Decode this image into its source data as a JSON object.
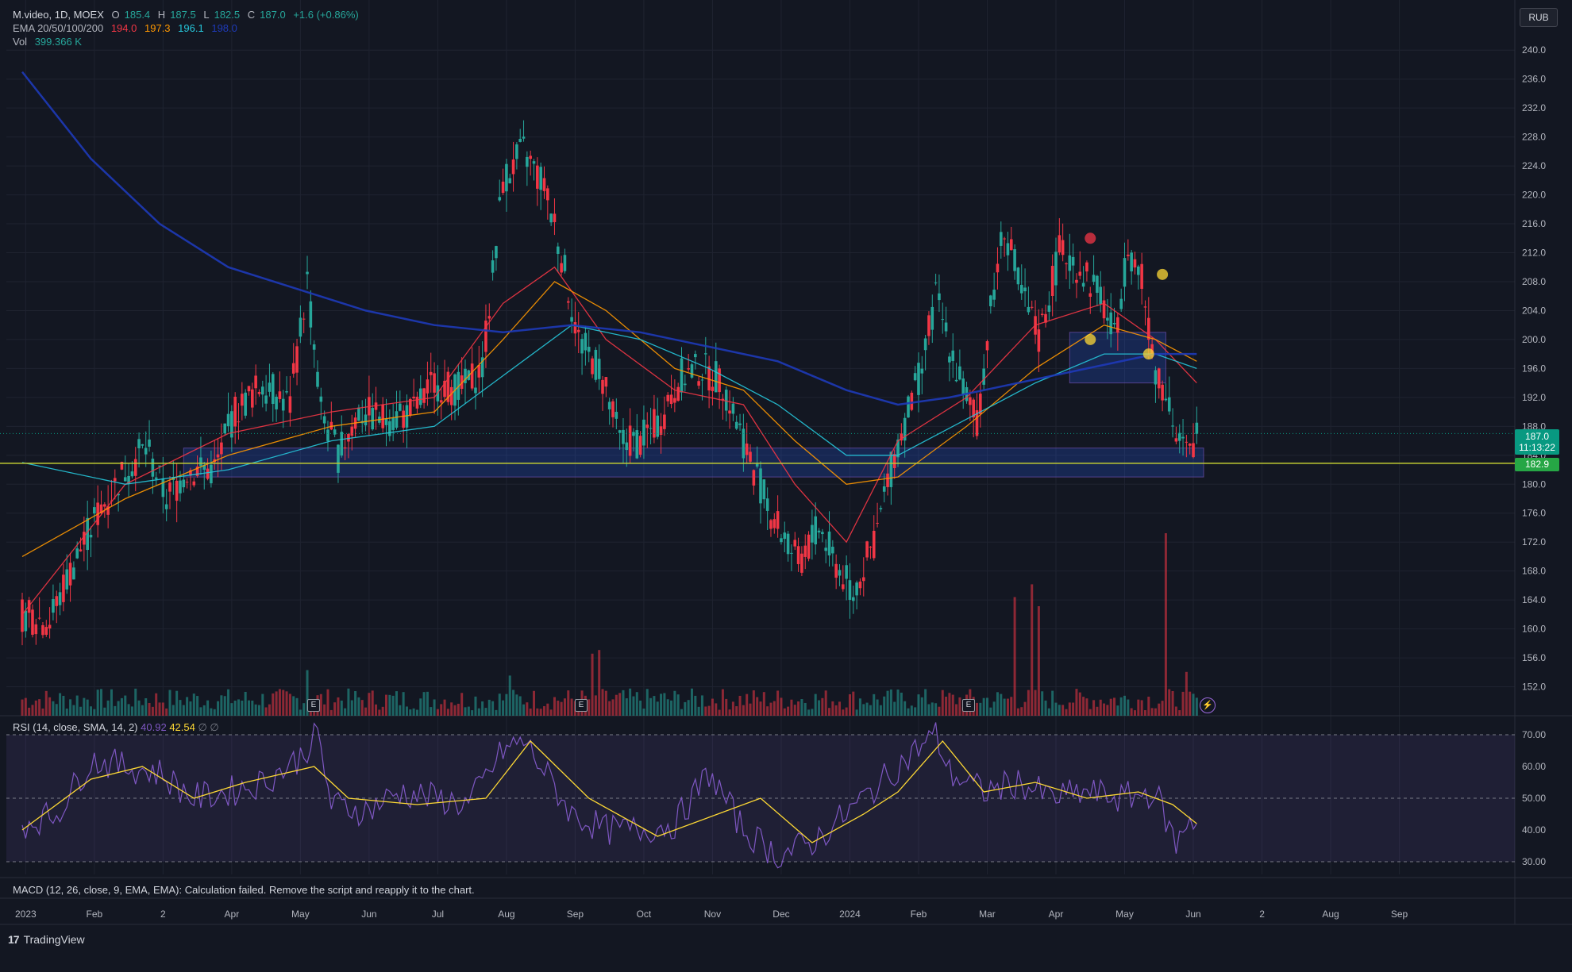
{
  "legend": {
    "symbol": "M.video, 1D, MOEX",
    "ohlc": [
      {
        "k": "O",
        "v": "185.4"
      },
      {
        "k": "H",
        "v": "187.5"
      },
      {
        "k": "L",
        "v": "182.5"
      },
      {
        "k": "C",
        "v": "187.0"
      }
    ],
    "change": "+1.6 (+0.86%)",
    "ema_label": "EMA 20/50/100/200",
    "ema_values": [
      {
        "v": "194.0",
        "color": "#f23645"
      },
      {
        "v": "197.3",
        "color": "#ff9800"
      },
      {
        "v": "196.1",
        "color": "#26c6da"
      },
      {
        "v": "198.0",
        "color": "#1e3ab8"
      }
    ],
    "vol_label": "Vol",
    "vol_value": "399.366 K",
    "rsi_label": "RSI (14, close, SMA, 14, 2)",
    "rsi_value": "40.92",
    "rsi_ma_value": "42.54",
    "rsi_extra": "∅  ∅",
    "macd_message": "MACD (12, 26, close, 9, EMA, EMA): Calculation failed. Remove the script and reapply it to the chart."
  },
  "currency": "RUB",
  "brand": "TradingView",
  "price_tags": {
    "last_price": "187.0",
    "countdown": "11:13:22",
    "level": "182.9"
  },
  "earnings_badge": "E",
  "colors": {
    "up": "#26a69a",
    "down": "#f23645",
    "ema20": "#f23645",
    "ema50": "#ff9800",
    "ema100": "#26c6da",
    "ema200": "#1e3ab8",
    "rsi": "#7e57c2",
    "rsi_ma": "#fdd835",
    "zone": "#2962ff",
    "level": "#c0ca33"
  },
  "chart_data": {
    "type": "candlestick",
    "title": "M.video, 1D, MOEX",
    "price_axis": {
      "min": 148,
      "max": 242,
      "ticks": [
        152,
        156,
        160,
        164,
        168,
        172,
        176,
        180,
        184,
        188,
        192,
        196,
        200,
        204,
        208,
        212,
        216,
        220,
        224,
        228,
        232,
        236,
        240
      ],
      "tick_labels": [
        "152.0",
        "156.0",
        "160.0",
        "164.0",
        "168.0",
        "172.0",
        "176.0",
        "180.0",
        "184.0",
        "188.0",
        "192.0",
        "196.0",
        "200.0",
        "204.0",
        "208.0",
        "212.0",
        "216.0",
        "220.0",
        "224.0",
        "228.0",
        "232.0",
        "236.0",
        "240.0"
      ]
    },
    "time_axis": {
      "labels": [
        "2023",
        "Feb",
        "2",
        "Apr",
        "May",
        "Jun",
        "Jul",
        "Aug",
        "Sep",
        "Oct",
        "Nov",
        "Dec",
        "2024",
        "Feb",
        "Mar",
        "Apr",
        "May",
        "Jun",
        "2",
        "Aug",
        "Sep"
      ],
      "label_index": [
        1,
        21,
        41,
        61,
        81,
        101,
        121,
        141,
        161,
        181,
        201,
        221,
        241,
        261,
        281,
        301,
        321,
        341,
        361,
        381,
        401
      ]
    },
    "price_path": [
      [
        0,
        162
      ],
      [
        8,
        161
      ],
      [
        14,
        168
      ],
      [
        22,
        176
      ],
      [
        30,
        182
      ],
      [
        36,
        185
      ],
      [
        42,
        178
      ],
      [
        48,
        182
      ],
      [
        56,
        182
      ],
      [
        62,
        190
      ],
      [
        70,
        194
      ],
      [
        78,
        191
      ],
      [
        83,
        208
      ],
      [
        87,
        190
      ],
      [
        92,
        184
      ],
      [
        98,
        190
      ],
      [
        106,
        189
      ],
      [
        114,
        190
      ],
      [
        120,
        194
      ],
      [
        128,
        193
      ],
      [
        134,
        196
      ],
      [
        140,
        222
      ],
      [
        146,
        226
      ],
      [
        152,
        221
      ],
      [
        156,
        214
      ],
      [
        162,
        200
      ],
      [
        168,
        196
      ],
      [
        174,
        186
      ],
      [
        180,
        186
      ],
      [
        186,
        189
      ],
      [
        192,
        195
      ],
      [
        198,
        196
      ],
      [
        204,
        194
      ],
      [
        210,
        186
      ],
      [
        218,
        176
      ],
      [
        226,
        169
      ],
      [
        232,
        174
      ],
      [
        238,
        168
      ],
      [
        242,
        165
      ],
      [
        248,
        172
      ],
      [
        254,
        184
      ],
      [
        262,
        196
      ],
      [
        266,
        206
      ],
      [
        272,
        196
      ],
      [
        278,
        188
      ],
      [
        282,
        204
      ],
      [
        286,
        216
      ],
      [
        290,
        208
      ],
      [
        296,
        200
      ],
      [
        302,
        212
      ],
      [
        308,
        210
      ],
      [
        314,
        206
      ],
      [
        318,
        200
      ],
      [
        322,
        213
      ],
      [
        326,
        208
      ],
      [
        330,
        196
      ],
      [
        334,
        192
      ],
      [
        336,
        186
      ],
      [
        340,
        184
      ],
      [
        342,
        187
      ]
    ],
    "ema_series": [
      {
        "period": 20,
        "values": [
          [
            0,
            162
          ],
          [
            30,
            180
          ],
          [
            60,
            187
          ],
          [
            90,
            190
          ],
          [
            120,
            192
          ],
          [
            140,
            205
          ],
          [
            155,
            210
          ],
          [
            170,
            200
          ],
          [
            190,
            193
          ],
          [
            210,
            191
          ],
          [
            225,
            180
          ],
          [
            240,
            172
          ],
          [
            255,
            186
          ],
          [
            275,
            192
          ],
          [
            295,
            202
          ],
          [
            315,
            205
          ],
          [
            330,
            200
          ],
          [
            342,
            194
          ]
        ]
      },
      {
        "period": 50,
        "values": [
          [
            0,
            170
          ],
          [
            30,
            178
          ],
          [
            60,
            184
          ],
          [
            90,
            188
          ],
          [
            120,
            190
          ],
          [
            140,
            200
          ],
          [
            155,
            208
          ],
          [
            170,
            204
          ],
          [
            190,
            196
          ],
          [
            210,
            193
          ],
          [
            225,
            186
          ],
          [
            240,
            180
          ],
          [
            255,
            181
          ],
          [
            275,
            188
          ],
          [
            295,
            196
          ],
          [
            315,
            202
          ],
          [
            330,
            200
          ],
          [
            342,
            197
          ]
        ]
      },
      {
        "period": 100,
        "values": [
          [
            0,
            183
          ],
          [
            30,
            180
          ],
          [
            60,
            182
          ],
          [
            90,
            186
          ],
          [
            120,
            188
          ],
          [
            140,
            195
          ],
          [
            160,
            202
          ],
          [
            180,
            200
          ],
          [
            200,
            196
          ],
          [
            220,
            191
          ],
          [
            240,
            184
          ],
          [
            255,
            184
          ],
          [
            275,
            189
          ],
          [
            295,
            194
          ],
          [
            315,
            198
          ],
          [
            330,
            198
          ],
          [
            342,
            196
          ]
        ]
      },
      {
        "period": 200,
        "values": [
          [
            0,
            237
          ],
          [
            20,
            225
          ],
          [
            40,
            216
          ],
          [
            60,
            210
          ],
          [
            80,
            207
          ],
          [
            100,
            204
          ],
          [
            120,
            202
          ],
          [
            140,
            201
          ],
          [
            160,
            202
          ],
          [
            180,
            201
          ],
          [
            200,
            199
          ],
          [
            220,
            197
          ],
          [
            240,
            193
          ],
          [
            255,
            191
          ],
          [
            270,
            192
          ],
          [
            290,
            194
          ],
          [
            310,
            196
          ],
          [
            330,
            198
          ],
          [
            342,
            198
          ]
        ]
      }
    ],
    "zones": [
      {
        "from_index": 47,
        "to_index": 344,
        "low": 181,
        "high": 185
      },
      {
        "from_index": 305,
        "to_index": 333,
        "low": 194,
        "high": 201
      }
    ],
    "horizontal_level": 182.9,
    "last_price": 187.0,
    "signal_markers": [
      {
        "index": 311,
        "price": 214,
        "color": "#f23645"
      },
      {
        "index": 311,
        "price": 200,
        "color": "#fdd835"
      },
      {
        "index": 328,
        "price": 198,
        "color": "#fdd835"
      },
      {
        "index": 332,
        "price": 209,
        "color": "#fdd835"
      }
    ],
    "earnings_events": [
      87,
      164,
      275
    ],
    "volume": {
      "scale_max": 100,
      "spikes": [
        [
          83,
          25
        ],
        [
          142,
          22
        ],
        [
          166,
          34
        ],
        [
          168,
          36
        ],
        [
          289,
          65
        ],
        [
          294,
          72
        ],
        [
          296,
          60
        ],
        [
          333,
          100
        ],
        [
          339,
          24
        ]
      ]
    },
    "rsi": {
      "levels": [
        30,
        50,
        70
      ],
      "tick_labels": [
        "70.00",
        "60.00",
        "50.00",
        "40.00",
        "30.00"
      ],
      "min": 26,
      "max": 74,
      "path": [
        [
          0,
          42
        ],
        [
          10,
          45
        ],
        [
          20,
          62
        ],
        [
          30,
          60
        ],
        [
          40,
          58
        ],
        [
          50,
          50
        ],
        [
          60,
          52
        ],
        [
          70,
          55
        ],
        [
          80,
          62
        ],
        [
          86,
          70
        ],
        [
          90,
          48
        ],
        [
          100,
          46
        ],
        [
          110,
          52
        ],
        [
          120,
          50
        ],
        [
          130,
          48
        ],
        [
          140,
          65
        ],
        [
          146,
          68
        ],
        [
          150,
          62
        ],
        [
          160,
          45
        ],
        [
          170,
          40
        ],
        [
          180,
          40
        ],
        [
          190,
          42
        ],
        [
          200,
          58
        ],
        [
          210,
          40
        ],
        [
          220,
          32
        ],
        [
          230,
          36
        ],
        [
          240,
          45
        ],
        [
          250,
          55
        ],
        [
          260,
          65
        ],
        [
          266,
          70
        ],
        [
          270,
          58
        ],
        [
          280,
          52
        ],
        [
          290,
          55
        ],
        [
          300,
          50
        ],
        [
          310,
          52
        ],
        [
          320,
          50
        ],
        [
          330,
          52
        ],
        [
          336,
          35
        ],
        [
          340,
          45
        ],
        [
          342,
          41
        ]
      ],
      "ma_path": [
        [
          0,
          40
        ],
        [
          20,
          56
        ],
        [
          35,
          60
        ],
        [
          50,
          50
        ],
        [
          65,
          55
        ],
        [
          85,
          60
        ],
        [
          95,
          50
        ],
        [
          115,
          48
        ],
        [
          135,
          50
        ],
        [
          148,
          68
        ],
        [
          165,
          50
        ],
        [
          185,
          38
        ],
        [
          200,
          44
        ],
        [
          215,
          50
        ],
        [
          230,
          36
        ],
        [
          245,
          45
        ],
        [
          255,
          52
        ],
        [
          268,
          68
        ],
        [
          280,
          52
        ],
        [
          295,
          55
        ],
        [
          310,
          50
        ],
        [
          325,
          52
        ],
        [
          335,
          48
        ],
        [
          342,
          42
        ]
      ]
    }
  }
}
